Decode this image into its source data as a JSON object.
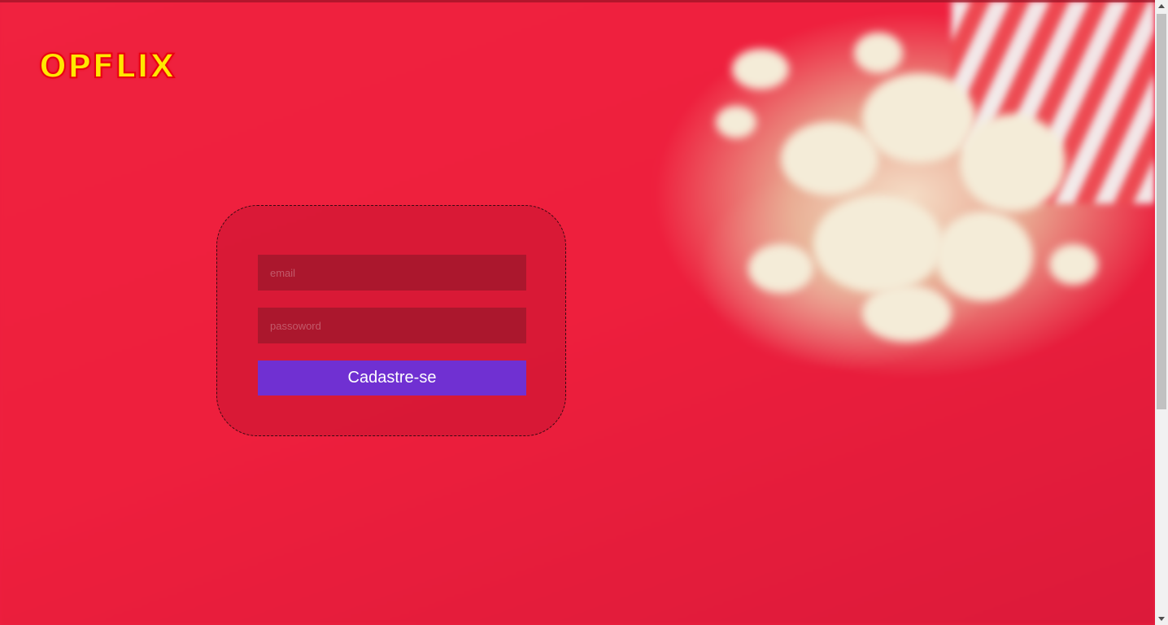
{
  "brand": {
    "logo_text": "OPFLIX",
    "logo_fill_color": "#ffe800",
    "logo_outline_color": "#e80010"
  },
  "background": {
    "description_icon": "popcorn-background-image",
    "base_color": "#ee2040"
  },
  "signup_form": {
    "email_placeholder": "email",
    "email_value": "",
    "password_placeholder": "passoword",
    "password_value": "",
    "submit_label": "Cadastre-se",
    "submit_color": "#7030d2",
    "field_color": "#ab172d"
  },
  "scrollbar": {
    "up_icon": "scroll-up-arrow-icon",
    "down_icon": "scroll-down-arrow-icon"
  }
}
